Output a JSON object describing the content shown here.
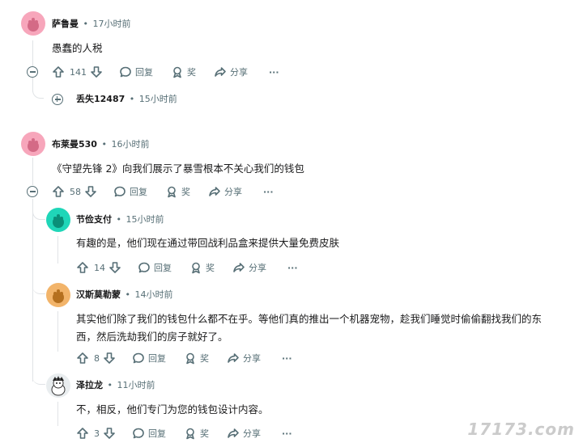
{
  "comments": [
    {
      "id": "c1",
      "user": "萨鲁曼",
      "time": "17小时前",
      "body": "愚蠢的人税",
      "votes": "141"
    },
    {
      "id": "c1r1",
      "user": "丢失12487",
      "time": "15小时前"
    },
    {
      "id": "c2",
      "user": "布莱曼530",
      "time": "16小时前",
      "body": "《守望先锋 2》向我们展示了暴雪根本不关心我们的钱包",
      "votes": "58"
    },
    {
      "id": "c2r1",
      "user": "节俭支付",
      "time": "15小时前",
      "body": "有趣的是，他们现在通过带回战利品盒来提供大量免费皮肤",
      "votes": "14"
    },
    {
      "id": "c2r2",
      "user": "汉斯莫勒蒙",
      "time": "14小时前",
      "body_line1": "其实他们除了我们的钱包什么都不在乎。等他们真的推出一个机器宠物，趁我们睡觉时偷偷翻找我们的东",
      "body_line2": "西，然后洗劫我们的房子就好了。",
      "votes": "8"
    },
    {
      "id": "c2r3",
      "user": "泽拉龙",
      "time": "11小时前",
      "body": "不，相反，他们专门为您的钱包设计内容。",
      "votes": "3"
    }
  ],
  "labels": {
    "sep": "•",
    "reply": "回复",
    "award": "奖",
    "share": "分享",
    "more": "···"
  },
  "watermark": "17173.com",
  "colors": {
    "pink_avatar": "#f7a6bb",
    "teal_avatar": "#1fd6b8",
    "orange_avatar": "#f2b46a"
  }
}
